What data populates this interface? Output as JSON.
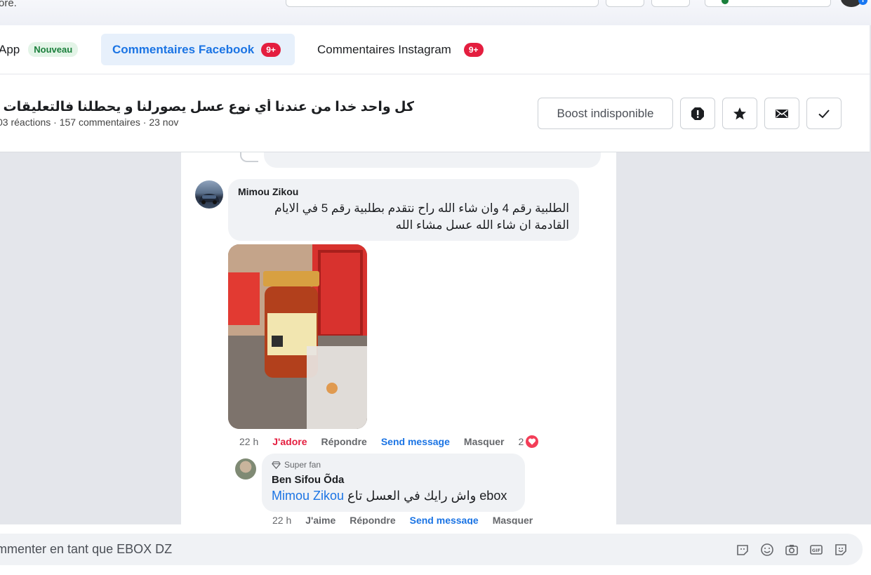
{
  "topbar": {
    "crumb_text": "ore."
  },
  "tabs": {
    "app_label": "App",
    "app_badge": "Nouveau",
    "facebook_label": "Commentaires Facebook",
    "facebook_count": "9+",
    "instagram_label": "Commentaires Instagram",
    "instagram_count": "9+"
  },
  "post": {
    "title": "كل واحد خدا من عندنا أي نوع عسل يصورلنا و يحطلنا فالتعليقات و صاحب...",
    "meta": "03 réactions · 157 commentaires · 23 nov",
    "boost_label": "Boost indisponible",
    "action_icons": [
      "alert-icon",
      "star-icon",
      "envelope-icon",
      "check-icon"
    ]
  },
  "comments": [
    {
      "author": "Mimou Zikou",
      "text": "الطلبية رقم 4 وان شاء الله راح نتقدم بطلبية رقم 5 في الايام القادمة ان شاء الله عسل مشاء الله",
      "time": "22 h",
      "love_label": "J'adore",
      "reply_label": "Répondre",
      "send_label": "Send message",
      "hide_label": "Masquer",
      "reaction_count": "2"
    },
    {
      "badge": "Super fan",
      "author": "Ben Sifou Õda",
      "mention": "Mimou Zikou",
      "text": "واش رايك في العسل تاع ebox",
      "time": "22 h",
      "like_label": "J'aime",
      "reply_label": "Répondre",
      "send_label": "Send message",
      "hide_label": "Masquer"
    }
  ],
  "composer": {
    "placeholder": "mmenter en tant que EBOX DZ",
    "icons": [
      "sticker-icon",
      "emoji-icon",
      "camera-icon",
      "gif-icon",
      "avatar-sticker-icon"
    ]
  }
}
